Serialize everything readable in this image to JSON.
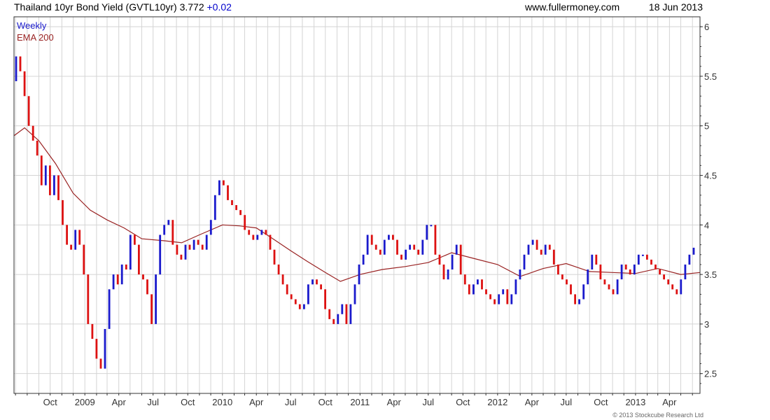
{
  "header": {
    "title": "Thailand 10yr Bond Yield (GVTL10yr) 3.772",
    "change": "+0.02",
    "site": "www.fullermoney.com",
    "date": "18 Jun 2013"
  },
  "footer": {
    "copyright": "© 2013 Stockcube Research Ltd"
  },
  "colors": {
    "up": "#1a1acc",
    "down": "#dd1111",
    "ema": "#992222",
    "grid": "#d4d4d4",
    "frame": "#333333"
  },
  "chart_data": {
    "type": "bar",
    "style": "weekly open-close candle bars",
    "legend": [
      {
        "label": "Weekly",
        "color": "#1a1acc"
      },
      {
        "label": "EMA 200",
        "color": "#992222"
      }
    ],
    "legend_position": "top-left",
    "grid": true,
    "y_axis_side": "right",
    "ylim": [
      2.3,
      6.1
    ],
    "y_ticks": [
      2.5,
      3,
      3.5,
      4,
      4.5,
      5,
      5.5,
      6
    ],
    "y_tick_labels": [
      "2.5",
      "3",
      "3.5",
      "4",
      "4.5",
      "5",
      "5.5",
      "6"
    ],
    "x_start": "2008-06-27",
    "x_end": "2013-06-21",
    "x_ticks": [
      {
        "date": "2008-10-01",
        "label": "Oct"
      },
      {
        "date": "2009-01-01",
        "label": "2009"
      },
      {
        "date": "2009-04-01",
        "label": "Apr"
      },
      {
        "date": "2009-07-01",
        "label": "Jul"
      },
      {
        "date": "2009-10-01",
        "label": "Oct"
      },
      {
        "date": "2010-01-01",
        "label": "2010"
      },
      {
        "date": "2010-04-01",
        "label": "Apr"
      },
      {
        "date": "2010-07-01",
        "label": "Jul"
      },
      {
        "date": "2010-10-01",
        "label": "Oct"
      },
      {
        "date": "2011-01-01",
        "label": "2011"
      },
      {
        "date": "2011-04-01",
        "label": "Apr"
      },
      {
        "date": "2011-07-01",
        "label": "Jul"
      },
      {
        "date": "2011-10-01",
        "label": "Oct"
      },
      {
        "date": "2012-01-01",
        "label": "2012"
      },
      {
        "date": "2012-04-01",
        "label": "Apr"
      },
      {
        "date": "2012-07-01",
        "label": "Jul"
      },
      {
        "date": "2012-10-01",
        "label": "Oct"
      },
      {
        "date": "2013-01-01",
        "label": "2013"
      },
      {
        "date": "2013-04-01",
        "label": "Apr"
      }
    ],
    "series": [
      {
        "name": "Weekly",
        "closes": [
          5.7,
          5.55,
          5.3,
          5.0,
          4.85,
          4.7,
          4.4,
          4.6,
          4.3,
          4.5,
          4.25,
          4.0,
          3.8,
          3.75,
          3.95,
          3.8,
          3.5,
          3.0,
          2.85,
          2.65,
          2.55,
          2.95,
          3.35,
          3.5,
          3.4,
          3.6,
          3.55,
          3.9,
          3.8,
          3.5,
          3.45,
          3.3,
          3.0,
          3.5,
          3.9,
          4.0,
          4.05,
          3.8,
          3.7,
          3.65,
          3.8,
          3.75,
          3.85,
          3.8,
          3.75,
          3.9,
          4.05,
          4.3,
          4.45,
          4.4,
          4.25,
          4.2,
          4.15,
          4.1,
          3.95,
          3.9,
          3.85,
          3.9,
          3.95,
          3.9,
          3.75,
          3.6,
          3.5,
          3.4,
          3.3,
          3.25,
          3.2,
          3.15,
          3.2,
          3.4,
          3.45,
          3.4,
          3.35,
          3.15,
          3.05,
          3.0,
          3.1,
          3.2,
          3.0,
          3.2,
          3.4,
          3.6,
          3.7,
          3.9,
          3.8,
          3.75,
          3.7,
          3.85,
          3.9,
          3.85,
          3.7,
          3.65,
          3.75,
          3.8,
          3.75,
          3.7,
          3.85,
          4.0,
          4.0,
          3.7,
          3.6,
          3.45,
          3.55,
          3.7,
          3.8,
          3.5,
          3.4,
          3.3,
          3.4,
          3.45,
          3.35,
          3.3,
          3.25,
          3.2,
          3.3,
          3.35,
          3.2,
          3.3,
          3.45,
          3.55,
          3.7,
          3.8,
          3.85,
          3.75,
          3.7,
          3.8,
          3.75,
          3.6,
          3.5,
          3.45,
          3.4,
          3.3,
          3.2,
          3.25,
          3.4,
          3.55,
          3.7,
          3.6,
          3.45,
          3.4,
          3.35,
          3.3,
          3.45,
          3.6,
          3.55,
          3.5,
          3.6,
          3.7,
          3.7,
          3.65,
          3.6,
          3.55,
          3.5,
          3.45,
          3.4,
          3.35,
          3.3,
          3.45,
          3.6,
          3.7,
          3.77
        ]
      },
      {
        "name": "EMA 200",
        "points": [
          {
            "date": "2008-06-27",
            "value": 4.9
          },
          {
            "date": "2008-07-25",
            "value": 4.98
          },
          {
            "date": "2008-09-01",
            "value": 4.85
          },
          {
            "date": "2008-10-15",
            "value": 4.62
          },
          {
            "date": "2008-12-01",
            "value": 4.32
          },
          {
            "date": "2009-01-15",
            "value": 4.15
          },
          {
            "date": "2009-03-01",
            "value": 4.05
          },
          {
            "date": "2009-04-15",
            "value": 3.97
          },
          {
            "date": "2009-06-01",
            "value": 3.86
          },
          {
            "date": "2009-08-01",
            "value": 3.84
          },
          {
            "date": "2009-09-15",
            "value": 3.82
          },
          {
            "date": "2009-11-01",
            "value": 3.9
          },
          {
            "date": "2010-01-01",
            "value": 4.0
          },
          {
            "date": "2010-02-15",
            "value": 3.99
          },
          {
            "date": "2010-04-01",
            "value": 3.97
          },
          {
            "date": "2010-05-15",
            "value": 3.86
          },
          {
            "date": "2010-07-01",
            "value": 3.74
          },
          {
            "date": "2010-08-15",
            "value": 3.63
          },
          {
            "date": "2010-10-01",
            "value": 3.52
          },
          {
            "date": "2010-11-10",
            "value": 3.43
          },
          {
            "date": "2011-01-01",
            "value": 3.5
          },
          {
            "date": "2011-03-01",
            "value": 3.55
          },
          {
            "date": "2011-05-01",
            "value": 3.58
          },
          {
            "date": "2011-07-01",
            "value": 3.62
          },
          {
            "date": "2011-09-01",
            "value": 3.72
          },
          {
            "date": "2011-11-01",
            "value": 3.66
          },
          {
            "date": "2012-01-01",
            "value": 3.6
          },
          {
            "date": "2012-03-01",
            "value": 3.48
          },
          {
            "date": "2012-05-01",
            "value": 3.56
          },
          {
            "date": "2012-07-01",
            "value": 3.61
          },
          {
            "date": "2012-09-01",
            "value": 3.53
          },
          {
            "date": "2012-11-01",
            "value": 3.52
          },
          {
            "date": "2013-01-01",
            "value": 3.51
          },
          {
            "date": "2013-03-01",
            "value": 3.56
          },
          {
            "date": "2013-05-01",
            "value": 3.5
          },
          {
            "date": "2013-06-21",
            "value": 3.52
          }
        ]
      }
    ]
  }
}
